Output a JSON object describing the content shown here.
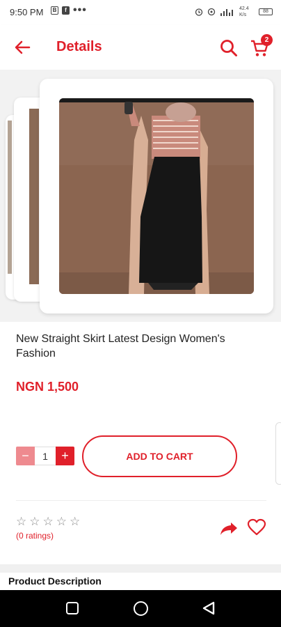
{
  "status_bar": {
    "time": "9:50 PM",
    "left_icons": [
      "notification-box-icon",
      "facebook-icon"
    ],
    "more": "•••",
    "speed": "42.4 K/s",
    "battery": "88"
  },
  "header": {
    "title": "Details",
    "back_icon": "arrow-left-icon",
    "search_icon": "search-icon",
    "cart_icon": "cart-icon",
    "cart_count": "2"
  },
  "product": {
    "name": "New Straight Skirt Latest Design Women's Fashion",
    "price": "NGN 1,500",
    "quantity": "1",
    "minus": "−",
    "plus": "+",
    "add_to_cart": "ADD TO CART",
    "ratings": "(0 ratings)",
    "stars": [
      "☆",
      "☆",
      "☆",
      "☆",
      "☆"
    ]
  },
  "sections": {
    "description_title": "Product Description"
  },
  "colors": {
    "accent": "#e0202a",
    "accent_light": "#ee8a8f"
  }
}
